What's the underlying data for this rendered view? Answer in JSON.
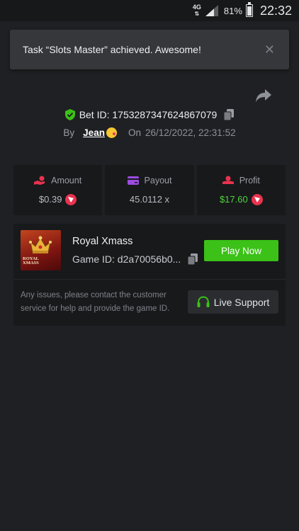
{
  "status_bar": {
    "network": "4G",
    "battery_percent": "81%",
    "battery_level": 0.81,
    "time": "22:32"
  },
  "toast": {
    "message": "Task “Slots Master” achieved. Awesome!",
    "close_icon": "close-icon"
  },
  "bet": {
    "id_label": "Bet ID: 1753287347624867079",
    "by_label": "By",
    "user": "Jean",
    "on_label": "On",
    "date": "26/12/2022, 22:31:52"
  },
  "stats": [
    {
      "label": "Amount",
      "value": "$0.39",
      "icon": "amount-icon",
      "currency_icon": "trx-icon",
      "color": "#b8bbc1"
    },
    {
      "label": "Payout",
      "value": "45.0112 x",
      "icon": "payout-icon",
      "color": "#b8bbc1"
    },
    {
      "label": "Profit",
      "value": "$17.60",
      "icon": "profit-icon",
      "currency_icon": "trx-icon",
      "color": "#4fd43b"
    }
  ],
  "game": {
    "thumb_text_line1": "ROYAL",
    "thumb_text_line2": "XMASS",
    "name": "Royal Xmass",
    "id_label": "Game ID: d2a70056b0...",
    "play_label": "Play Now",
    "issues_text": "Any issues, please contact the customer service for help and provide the game ID.",
    "support_label": "Live Support"
  },
  "colors": {
    "background": "#1f2023",
    "card": "#18191b",
    "accent_green": "#3bc117",
    "trx_red": "#e8334f"
  }
}
